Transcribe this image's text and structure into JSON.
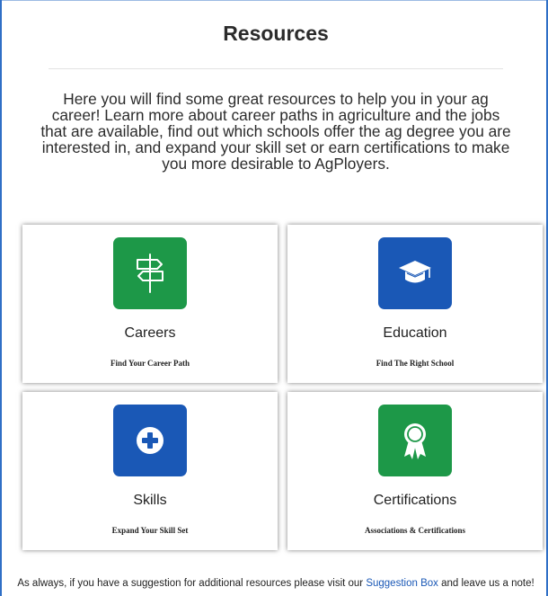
{
  "page": {
    "title": "Resources",
    "intro": "Here you will find some great resources to help you in your ag career!  Learn more about career paths in agriculture and the jobs that are available, find out which schools offer the ag degree you are interested in, and expand your skill set or earn certifications to make you more desirable to AgPloyers."
  },
  "cards": [
    {
      "title": "Careers",
      "subtitle": "Find Your Career Path",
      "icon": "signpost-icon",
      "color": "#1d9848"
    },
    {
      "title": "Education",
      "subtitle": "Find The Right School",
      "icon": "graduation-cap-icon",
      "color": "#1a58b6"
    },
    {
      "title": "Skills",
      "subtitle": "Expand Your Skill Set",
      "icon": "plus-circle-icon",
      "color": "#1a58b6"
    },
    {
      "title": "Certifications",
      "subtitle": "Associations & Certifications",
      "icon": "award-ribbon-icon",
      "color": "#1d9848"
    }
  ],
  "footer": {
    "before": "As always, if you have a suggestion for additional resources please visit our ",
    "link": "Suggestion Box",
    "after": " and leave us a note!"
  },
  "colors": {
    "green": "#1d9848",
    "blue": "#1a58b6",
    "frame": "#2f6fc6"
  }
}
